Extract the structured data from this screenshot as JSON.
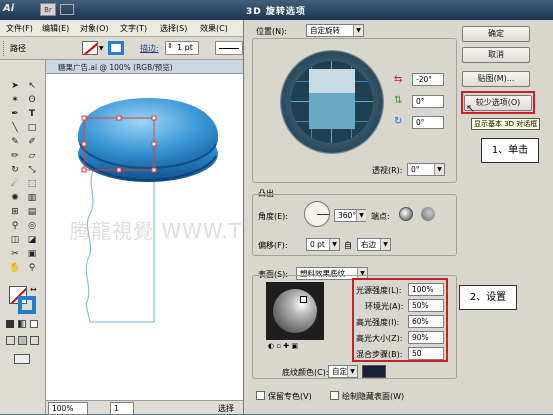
{
  "app": {
    "logo": "Ai",
    "bridge_icon": "Br",
    "dialog_title": "3D 旋转选项"
  },
  "menu": [
    "文件(F)",
    "编辑(E)",
    "对象(O)",
    "文字(T)",
    "选择(S)",
    "效果(C)"
  ],
  "control_bar": {
    "path_label": "路径",
    "stroke_label": "描边:",
    "stroke_value": "1 pt"
  },
  "document": {
    "title": "糖果广告.ai @ 100% (RGB/预览)",
    "watermark": "腾龍視覺 WWW.TLVI.NET",
    "zoom": "100%",
    "page": "1",
    "status": "选择"
  },
  "dialog": {
    "position_label": "位置(N):",
    "position_value": "自定旋转",
    "angle_x": "-20°",
    "angle_y": "0°",
    "angle_z": "0°",
    "perspective_label": "透视(R):",
    "perspective_value": "0°",
    "extrude_group": "凸出",
    "angle_label": "角度(E):",
    "angle_value": "360°",
    "endpoints_label": "端点:",
    "offset_label": "偏移(F):",
    "offset_value": "0 pt",
    "offset_from": "自",
    "offset_side": "右边",
    "surface_label": "表面(S):",
    "surface_value": "塑料效果底纹",
    "light_intensity_label": "光源强度(L):",
    "light_intensity": "100%",
    "ambient_label": "环境光(A):",
    "ambient": "50%",
    "highlight_intensity_label": "高光强度(I):",
    "highlight_intensity": "60%",
    "highlight_size_label": "高光大小(Z):",
    "highlight_size": "90%",
    "blend_steps_label": "混合步骤(B):",
    "blend_steps": "50",
    "shading_color_label": "底纹颜色(C):",
    "shading_color": "自定",
    "preserve_spot_label": "保留专色(V)",
    "draw_hidden_label": "绘制隐藏表面(W)"
  },
  "buttons": {
    "ok": "确定",
    "cancel": "取消",
    "map": "贴图(M)...",
    "fewer_options": "较少选项(O)"
  },
  "tooltip": "显示基本 3D 对话框",
  "callouts": {
    "step1": "1、单击",
    "step2": "2、设置"
  },
  "colors": {
    "highlight_red": "#c8202a",
    "dialog_bg": "#d9d6ce",
    "candy_blue": "#2a86c8"
  }
}
